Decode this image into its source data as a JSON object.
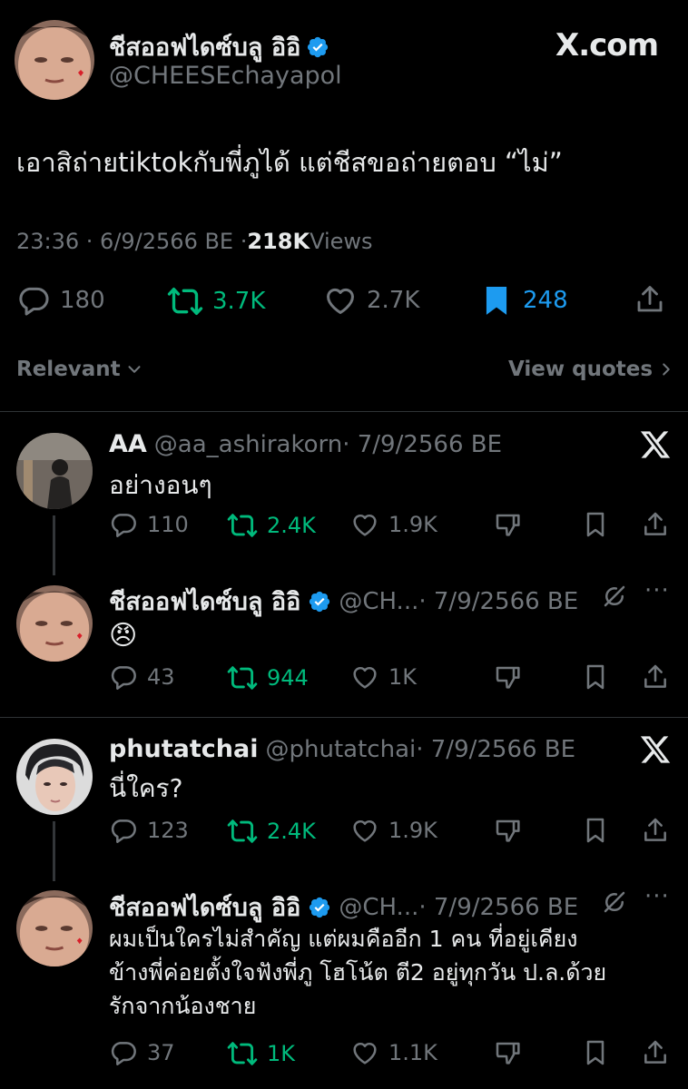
{
  "main_tweet": {
    "author_name": "ชีสออฟไดซ์บลู อิอิ",
    "author_handle": "@CHEESEchayapol",
    "brand": "X.com",
    "text": "เอาสิถ่ายtiktokกับพี่ภูได้ แต่ชีสขอถ่ายตอบ “ไม่”",
    "time": "23:36 · 6/9/2566 BE · ",
    "views_count": "218K",
    "views_label": " Views",
    "replies": "180",
    "reposts": "3.7K",
    "likes": "2.7K",
    "bookmarks": "248"
  },
  "filter": {
    "sort_label": "Relevant",
    "view_quotes_label": "View quotes"
  },
  "replies": [
    {
      "name": "AA",
      "handle": "@aa_ashirakorn",
      "date": " · 7/9/2566 BE",
      "text": "อย่างอนๆ",
      "replies": "110",
      "reposts": "2.4K",
      "likes": "1.9K"
    },
    {
      "name": "ชีสออฟไดซ์บลู อิอิ",
      "handle": "@CH...",
      "date": " · 7/9/2566 BE",
      "text": "😠",
      "replies": "43",
      "reposts": "944",
      "likes": "1K"
    },
    {
      "name": "phutatchai",
      "handle": "@phutatchai",
      "date": " · 7/9/2566 BE",
      "text": "นี่ใคร?",
      "replies": "123",
      "reposts": "2.4K",
      "likes": "1.9K"
    },
    {
      "name": "ชีสออฟไดซ์บลู อิอิ",
      "handle": "@CH...",
      "date": " · 7/9/2566 BE",
      "text_lines": [
        "ผมเป็นใครไม่สำคัญ แต่ผมคืออีก 1 คน ที่อยู่เคียง",
        "ข้างพี่ค่อยตั้งใจฟังพี่ภู โฮโน้ต ตี2 อยู่ทุกวัน ป.ล.ด้วย",
        "รักจากน้องชาย"
      ],
      "replies": "37",
      "reposts": "1K",
      "likes": "1.1K"
    }
  ],
  "colors": {
    "background": "#000000",
    "text": "#e7e9ea",
    "muted": "#71767b",
    "repost_green": "#00ba7c",
    "bookmark_blue": "#1d9bf0",
    "divider": "#2f3336"
  }
}
